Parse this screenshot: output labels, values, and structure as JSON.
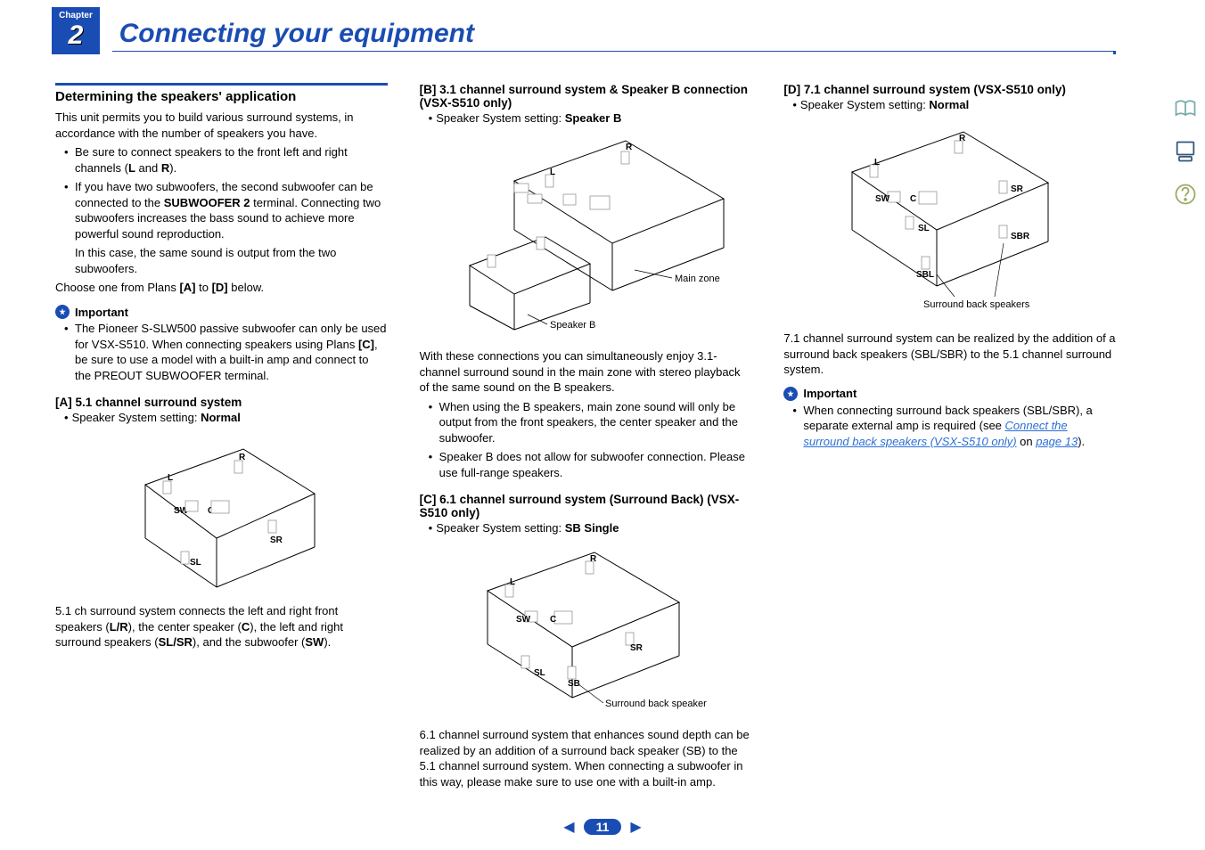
{
  "header": {
    "chapter_label": "Chapter",
    "chapter_number": "2",
    "chapter_title": "Connecting your equipment"
  },
  "page_number": "11",
  "col1": {
    "section_title": "Determining the speakers' application",
    "intro_p1": "This unit permits you to build various surround systems, in accordance with the number of speakers you have.",
    "bullets": {
      "b1_pre": "Be sure to connect speakers to the front left and right channels (",
      "b1_L": "L",
      "b1_and": " and ",
      "b1_R": "R",
      "b1_post": ").",
      "b2_pre": "If you have two subwoofers, the second subwoofer can be connected to the ",
      "b2_term": "SUBWOOFER 2",
      "b2_post": " terminal. Connecting two subwoofers increases the bass sound to achieve more powerful sound reproduction.",
      "b2_line2": "In this case, the same sound is output from the two subwoofers."
    },
    "choose_pre": "Choose one from Plans ",
    "choose_A": "[A]",
    "choose_to": " to ",
    "choose_D": "[D]",
    "choose_post": " below.",
    "important_label": "Important",
    "imp_bullet_pre": "The Pioneer S-SLW500 passive subwoofer can only be used for VSX-S510. When connecting speakers using Plans ",
    "imp_bullet_C": "[C]",
    "imp_bullet_post": ", be sure to use a model with a built-in amp and connect to the PREOUT SUBWOOFER terminal.",
    "planA_title": "[A] 5.1 channel surround system",
    "planA_setting_pre": "Speaker System setting: ",
    "planA_setting_val": "Normal",
    "planA_desc_1": "5.1 ch surround system connects the left and right front speakers (",
    "planA_LR": "L/R",
    "planA_desc_2": "), the center speaker (",
    "planA_C": "C",
    "planA_desc_3": "), the left and right surround speakers (",
    "planA_SLSR": "SL/SR",
    "planA_desc_4": "), and the subwoofer (",
    "planA_SW": "SW",
    "planA_desc_5": ")."
  },
  "diagA": {
    "L": "L",
    "R": "R",
    "SW": "SW",
    "C": "C",
    "SL": "SL",
    "SR": "SR"
  },
  "col2": {
    "planB_title": "[B] 3.1 channel surround system & Speaker B connection (VSX-S510 only)",
    "planB_setting_pre": "Speaker System setting: ",
    "planB_setting_val": "Speaker B",
    "diagB_main": "Main zone",
    "diagB_spb": "Speaker B",
    "diagB_L": "L",
    "diagB_R": "R",
    "planB_p1": "With these connections you can simultaneously enjoy 3.1-channel surround sound in the main zone with stereo playback of the same sound on the B speakers.",
    "planB_b1": "When using the B speakers, main zone sound will only be output from the front speakers, the center speaker and the subwoofer.",
    "planB_b2": "Speaker B does not allow for subwoofer connection. Please use full-range speakers.",
    "planC_title": "[C] 6.1 channel surround system (Surround Back) (VSX-S510 only)",
    "planC_setting_pre": "Speaker System setting: ",
    "planC_setting_val": "SB Single",
    "diagC_caption": "Surround back speaker",
    "planC_p1": "6.1 channel surround system that enhances sound depth can be realized by an addition of a surround back speaker (SB) to the 5.1 channel surround system. When connecting a subwoofer in this way, please make sure to use one with a built-in amp."
  },
  "diagC": {
    "L": "L",
    "R": "R",
    "SW": "SW",
    "C": "C",
    "SL": "SL",
    "SR": "SR",
    "SB": "SB"
  },
  "col3": {
    "planD_title": "[D] 7.1 channel surround system (VSX-S510 only)",
    "planD_setting_pre": "Speaker System setting: ",
    "planD_setting_val": "Normal",
    "diagD_caption": "Surround back speakers",
    "planD_p1": "7.1 channel surround system can be realized by the addition of a surround back speakers (SBL/SBR) to the 5.1 channel surround system.",
    "important_label": "Important",
    "imp_b1_pre": "When connecting surround back speakers (SBL/SBR), a separate external amp is required (see ",
    "imp_b1_link": "Connect the surround back speakers (VSX-S510 only)",
    "imp_b1_on": " on ",
    "imp_b1_page": "page 13",
    "imp_b1_post": ")."
  },
  "diagD": {
    "L": "L",
    "R": "R",
    "SW": "SW",
    "C": "C",
    "SL": "SL",
    "SR": "SR",
    "SBL": "SBL",
    "SBR": "SBR"
  }
}
